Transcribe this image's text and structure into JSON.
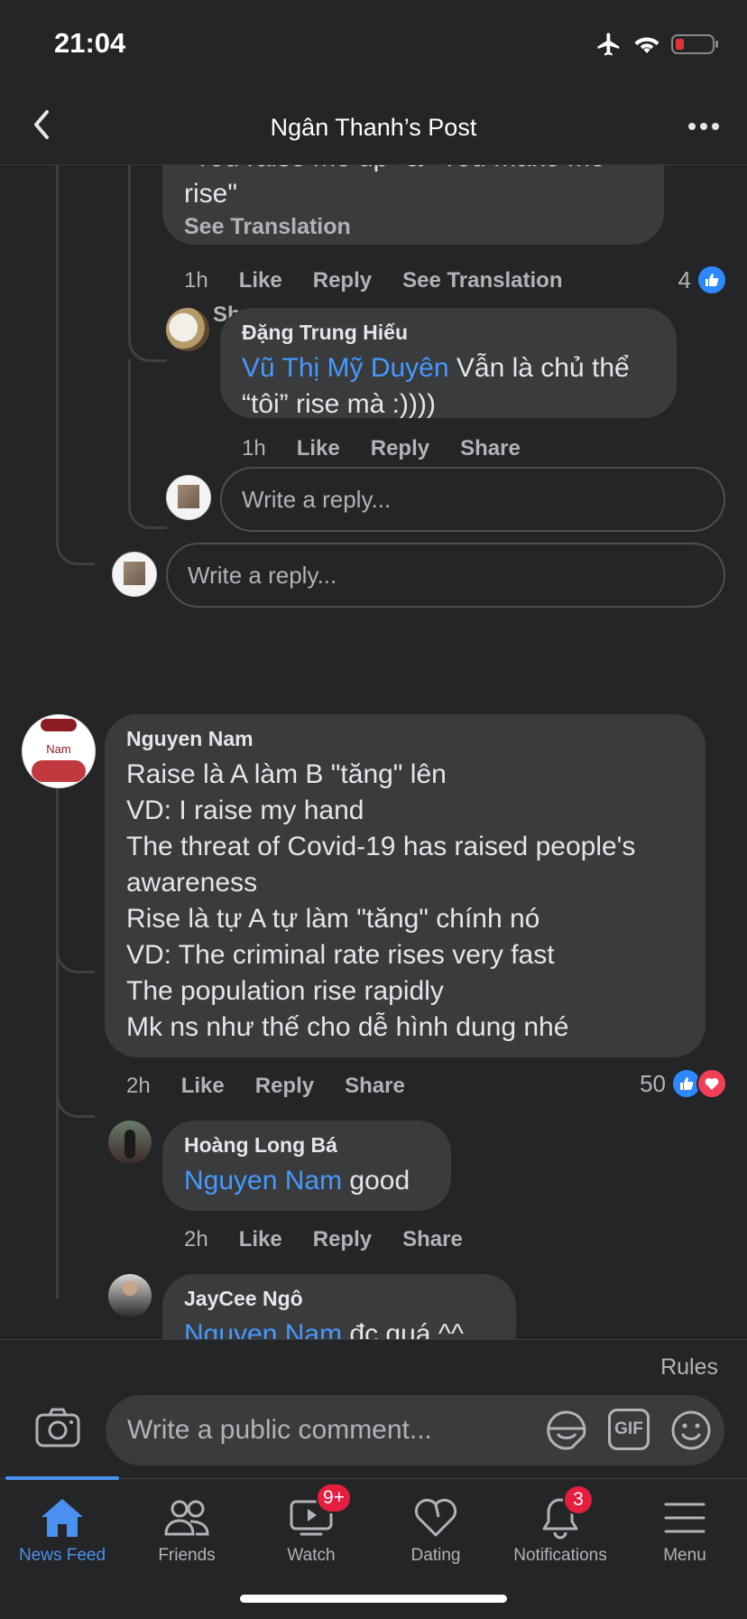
{
  "status_bar": {
    "time": "21:04"
  },
  "header": {
    "title": "Ngân Thanh’s Post"
  },
  "thread": {
    "prev_comment": {
      "text_line_cut": "\"You raise me up\" & \"You make me",
      "text_line2": "rise\"",
      "see_translation": "See Translation",
      "time": "1h",
      "like": "Like",
      "reply": "Reply",
      "see_translation_action": "See Translation",
      "share": "Share",
      "reaction_count": "4"
    },
    "reply_dang": {
      "author": "Đặng Trung Hiếu",
      "mention": "Vũ Thị Mỹ Duyên",
      "text_a": " Vẫn là chủ thể",
      "text_b": "“tôi” rise mà :))))",
      "time": "1h",
      "like": "Like",
      "reply": "Reply",
      "share": "Share"
    },
    "write_reply_inner": "Write a reply...",
    "write_reply_outer": "Write a reply..."
  },
  "comment_nam": {
    "author": "Nguyen Nam",
    "avatar_text": "Nam",
    "lines": [
      "Raise là A làm B \"tăng\" lên",
      "VD: I raise my hand",
      "The threat of Covid-19 has raised people's",
      "awareness",
      "Rise là tự A tự làm \"tăng\" chính nó",
      "VD: The criminal rate rises very fast",
      "The population rise rapidly",
      "Mk ns như thế cho dễ hình dung nhé"
    ],
    "time": "2h",
    "like": "Like",
    "reply": "Reply",
    "share": "Share",
    "reaction_count": "50"
  },
  "reply_hoang": {
    "author": "Hoàng Long Bá",
    "mention": "Nguyen Nam",
    "text": " good",
    "time": "2h",
    "like": "Like",
    "reply": "Reply",
    "share": "Share"
  },
  "reply_jaycee": {
    "author": "JayCee Ngô",
    "mention": "Nguyen Nam",
    "text": " đc quá ^^"
  },
  "composer": {
    "rules": "Rules",
    "placeholder": "Write a public comment...",
    "gif": "GIF"
  },
  "tabs": [
    {
      "label": "News Feed",
      "icon": "home-icon",
      "active": true
    },
    {
      "label": "Friends",
      "icon": "friends-icon"
    },
    {
      "label": "Watch",
      "icon": "watch-icon",
      "badge": "9+"
    },
    {
      "label": "Dating",
      "icon": "dating-icon"
    },
    {
      "label": "Notifications",
      "icon": "bell-icon",
      "badge": "3"
    },
    {
      "label": "Menu",
      "icon": "menu-icon"
    }
  ],
  "colors": {
    "background": "#242526",
    "bubble": "#3a3b3c",
    "mention": "#4599ff",
    "active_tab": "#4a90f0",
    "badge": "#e41e3f"
  }
}
